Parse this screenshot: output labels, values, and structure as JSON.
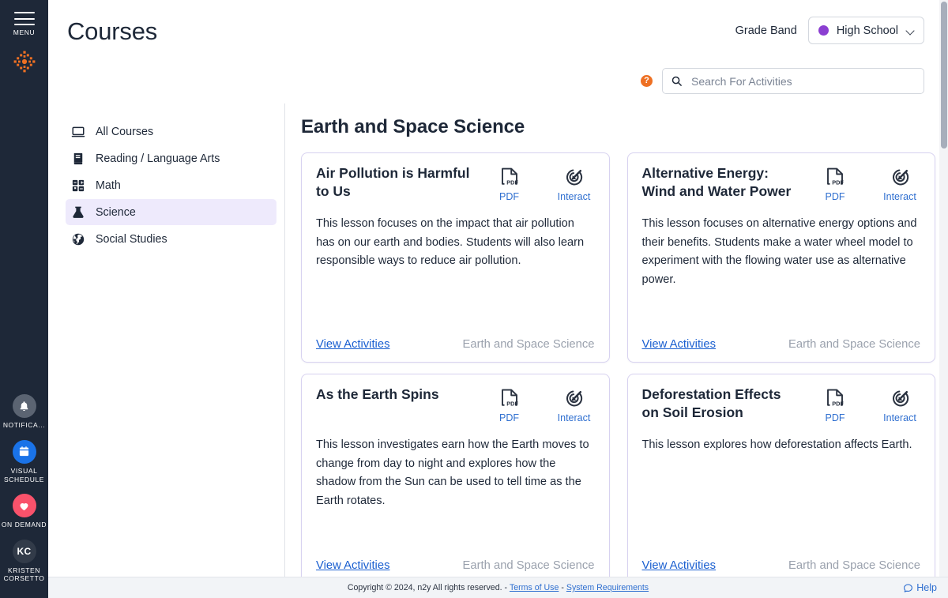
{
  "rail": {
    "menu_label": "MENU",
    "logo_name": "n2y-logo",
    "items": [
      {
        "id": "notifications",
        "label": "NOTIFICA...",
        "icon": "bell-icon",
        "color": "#5b6472"
      },
      {
        "id": "visual-schedule",
        "label": "VISUAL SCHEDULE",
        "icon": "calendar-icon",
        "color": "#1a73e8"
      },
      {
        "id": "on-demand",
        "label": "ON DEMAND",
        "icon": "heart-icon",
        "color": "#f9526b"
      },
      {
        "id": "user",
        "label": "KRISTEN CORSETTO",
        "icon": "avatar",
        "initials": "KC",
        "color": "#323b49"
      }
    ]
  },
  "header": {
    "title": "Courses",
    "grade_band_label": "Grade Band",
    "grade_band_value": "High School",
    "grade_band_dot_color": "#8b3fd1",
    "help_badge": "?",
    "search_placeholder": "Search For Activities",
    "search_value": ""
  },
  "subnav": {
    "items": [
      {
        "label": "All Courses",
        "icon": "monitor-icon",
        "active": false
      },
      {
        "label": "Reading / Language Arts",
        "icon": "book-icon",
        "active": false
      },
      {
        "label": "Math",
        "icon": "calculator-icon",
        "active": false
      },
      {
        "label": "Science",
        "icon": "flask-icon",
        "active": true
      },
      {
        "label": "Social Studies",
        "icon": "globe-icon",
        "active": false
      }
    ]
  },
  "main": {
    "section_title": "Earth and Space Science",
    "pdf_label": "PDF",
    "interact_label": "Interact",
    "view_activities_label": "View Activities",
    "cards": [
      {
        "title": "Air Pollution is Harmful to Us",
        "description": "This lesson focuses on the impact that air pollution has on our earth and bodies. Students will also learn responsible ways to reduce air pollution.",
        "subject": "Earth and Space Science"
      },
      {
        "title": "Alternative Energy: Wind and Water Power",
        "description": "This lesson focuses on alternative energy options and their benefits. Students make a water wheel model to experiment with the flowing water use as alternative power.",
        "subject": "Earth and Space Science"
      },
      {
        "title": "As the Earth Spins",
        "description": "This lesson investigates earn how the Earth moves to change from day to night and explores how the shadow from the Sun can be used to tell time as the Earth rotates.",
        "subject": "Earth and Space Science"
      },
      {
        "title": "Deforestation Effects on Soil Erosion",
        "description": "This lesson explores how deforestation affects Earth.",
        "subject": "Earth and Space Science"
      }
    ]
  },
  "footer": {
    "copyright": "Copyright © 2024, n2y All rights reserved. -",
    "terms_label": "Terms of Use",
    "separator": "-",
    "system_req_label": "System Requirements",
    "help_label": "Help"
  },
  "colors": {
    "rail_bg": "#1e2838",
    "accent_orange": "#ee7023",
    "link_blue": "#2f6fd0",
    "active_nav_bg": "#eeeafc",
    "card_border": "#d7d2f0"
  }
}
